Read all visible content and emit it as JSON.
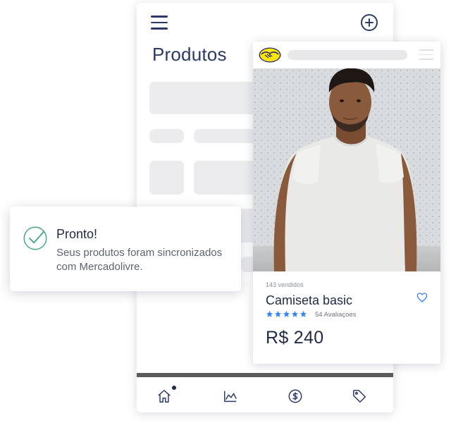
{
  "app": {
    "page_title": "Produtos",
    "icons": {
      "menu": "hamburger-menu-icon",
      "add": "plus-circle-icon"
    },
    "tabbar": [
      {
        "name": "home",
        "icon": "home-icon",
        "active": true
      },
      {
        "name": "analytics",
        "icon": "chart-icon",
        "active": false
      },
      {
        "name": "finance",
        "icon": "dollar-circle-icon",
        "active": false
      },
      {
        "name": "tags",
        "icon": "tag-icon",
        "active": false
      }
    ]
  },
  "product_card": {
    "logo": "mercadolivre-handshake-logo",
    "sold_count": "143 vendidos",
    "name": "Camiseta basic",
    "rating_stars": 5,
    "reviews": "54 Avaliaçoes",
    "price": "R$ 240",
    "star_color": "#3483fa",
    "heart_icon": "heart-icon"
  },
  "toast": {
    "title": "Pronto!",
    "message": "Seus produtos foram sincronizados com Mercadolivre.",
    "icon": "check-circle-icon",
    "icon_color": "#3fa87c"
  },
  "colors": {
    "navy": "#2b3a67",
    "skeleton": "#ececef",
    "brand_yellow": "#ffe600"
  }
}
